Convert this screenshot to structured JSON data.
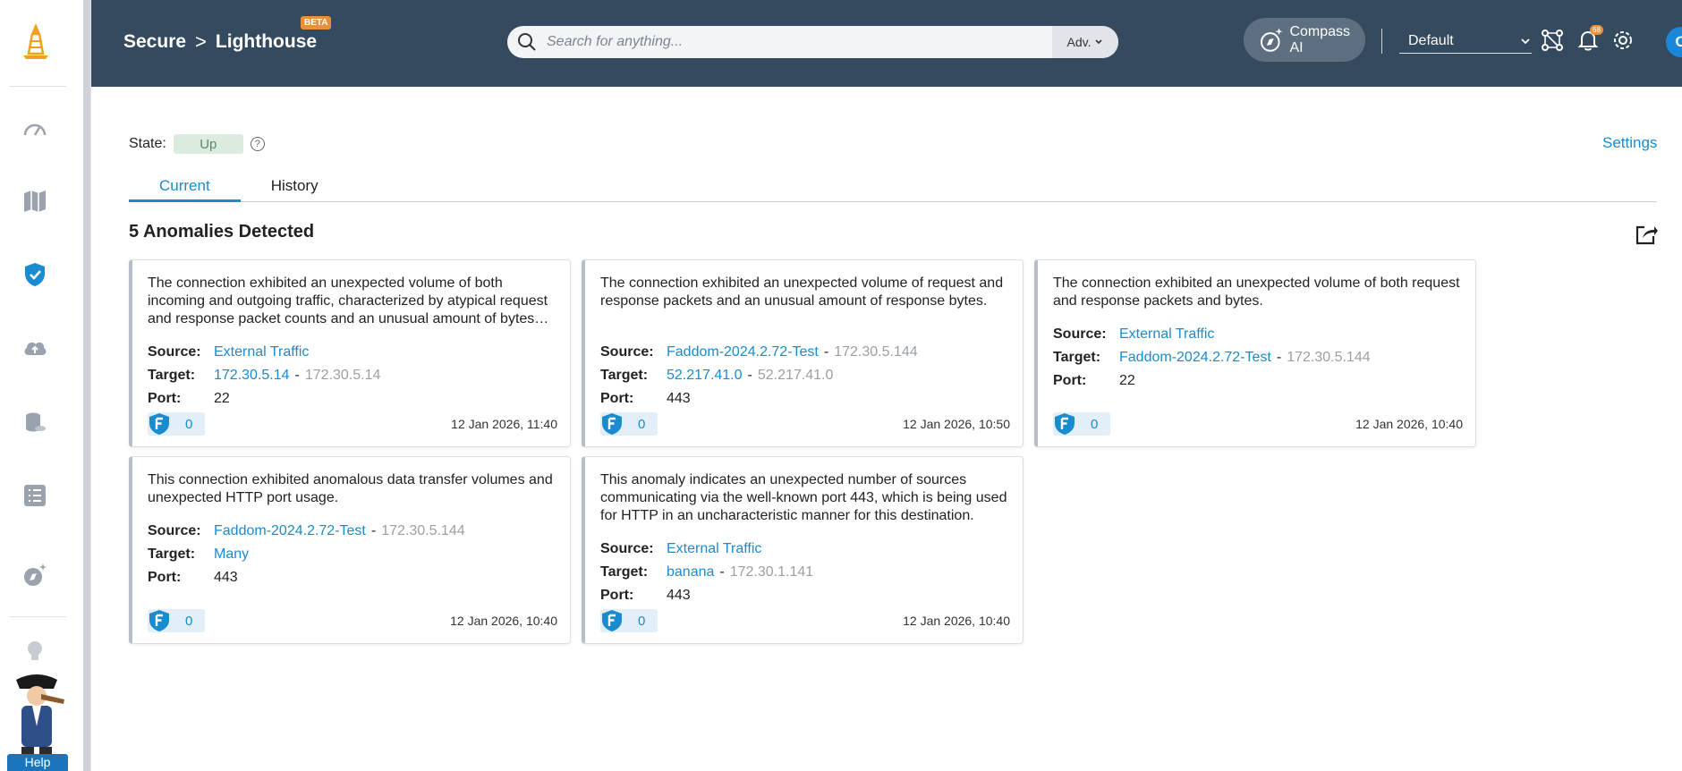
{
  "header": {
    "breadcrumb": [
      "Secure",
      "Lighthouse"
    ],
    "breadcrumb_sep": ">",
    "beta": "BETA",
    "search_placeholder": "Search for anything...",
    "adv_label": "Adv.",
    "compass_label": "Compass AI",
    "view_select": "Default",
    "notification_count": "68",
    "avatar_initial": "O"
  },
  "sidebar": {
    "help_label": "Help"
  },
  "main": {
    "state_label": "State:",
    "state_value": "Up",
    "settings_link": "Settings",
    "tabs": [
      {
        "label": "Current"
      },
      {
        "label": "History"
      }
    ],
    "title": "5 Anomalies Detected"
  },
  "labels": {
    "source": "Source:",
    "target": "Target:",
    "port": "Port:",
    "dash": "-"
  },
  "anomalies": [
    {
      "description": "The connection exhibited an unexpected volume of both incoming and outgoing traffic, characterized by atypical request and response packet counts and an unusual amount of bytes transferred.",
      "source": "External Traffic",
      "source_ip": "",
      "target": "172.30.5.14",
      "target_ip": "172.30.5.14",
      "port": "22",
      "count": "0",
      "timestamp": "12 Jan 2026, 11:40"
    },
    {
      "description": "The connection exhibited an unexpected volume of request and response packets and an unusual amount of response bytes.",
      "source": "Faddom-2024.2.72-Test",
      "source_ip": "172.30.5.144",
      "target": "52.217.41.0",
      "target_ip": "52.217.41.0",
      "port": "443",
      "count": "0",
      "timestamp": "12 Jan 2026, 10:50"
    },
    {
      "description": "The connection exhibited an unexpected volume of both request and response packets and bytes.",
      "source": "External Traffic",
      "source_ip": "",
      "target": "Faddom-2024.2.72-Test",
      "target_ip": "172.30.5.144",
      "port": "22",
      "count": "0",
      "timestamp": "12 Jan 2026, 10:40"
    },
    {
      "description": "This connection exhibited anomalous data transfer volumes and unexpected HTTP port usage.",
      "source": "Faddom-2024.2.72-Test",
      "source_ip": "172.30.5.144",
      "target": "Many",
      "target_ip": "",
      "port": "443",
      "count": "0",
      "timestamp": "12 Jan 2026, 10:40"
    },
    {
      "description": "This anomaly indicates an unexpected number of sources communicating via the well-known port 443, which is being used for HTTP in an uncharacteristic manner for this destination.",
      "source": "External Traffic",
      "source_ip": "",
      "target": "banana",
      "target_ip": "172.30.1.141",
      "port": "443",
      "count": "0",
      "timestamp": "12 Jan 2026, 10:40"
    }
  ],
  "colors": {
    "header_bg": "#344a5e",
    "accent": "#1b8bd0",
    "state_up_bg": "#dcebe0",
    "badge_orange": "#e8913a"
  }
}
